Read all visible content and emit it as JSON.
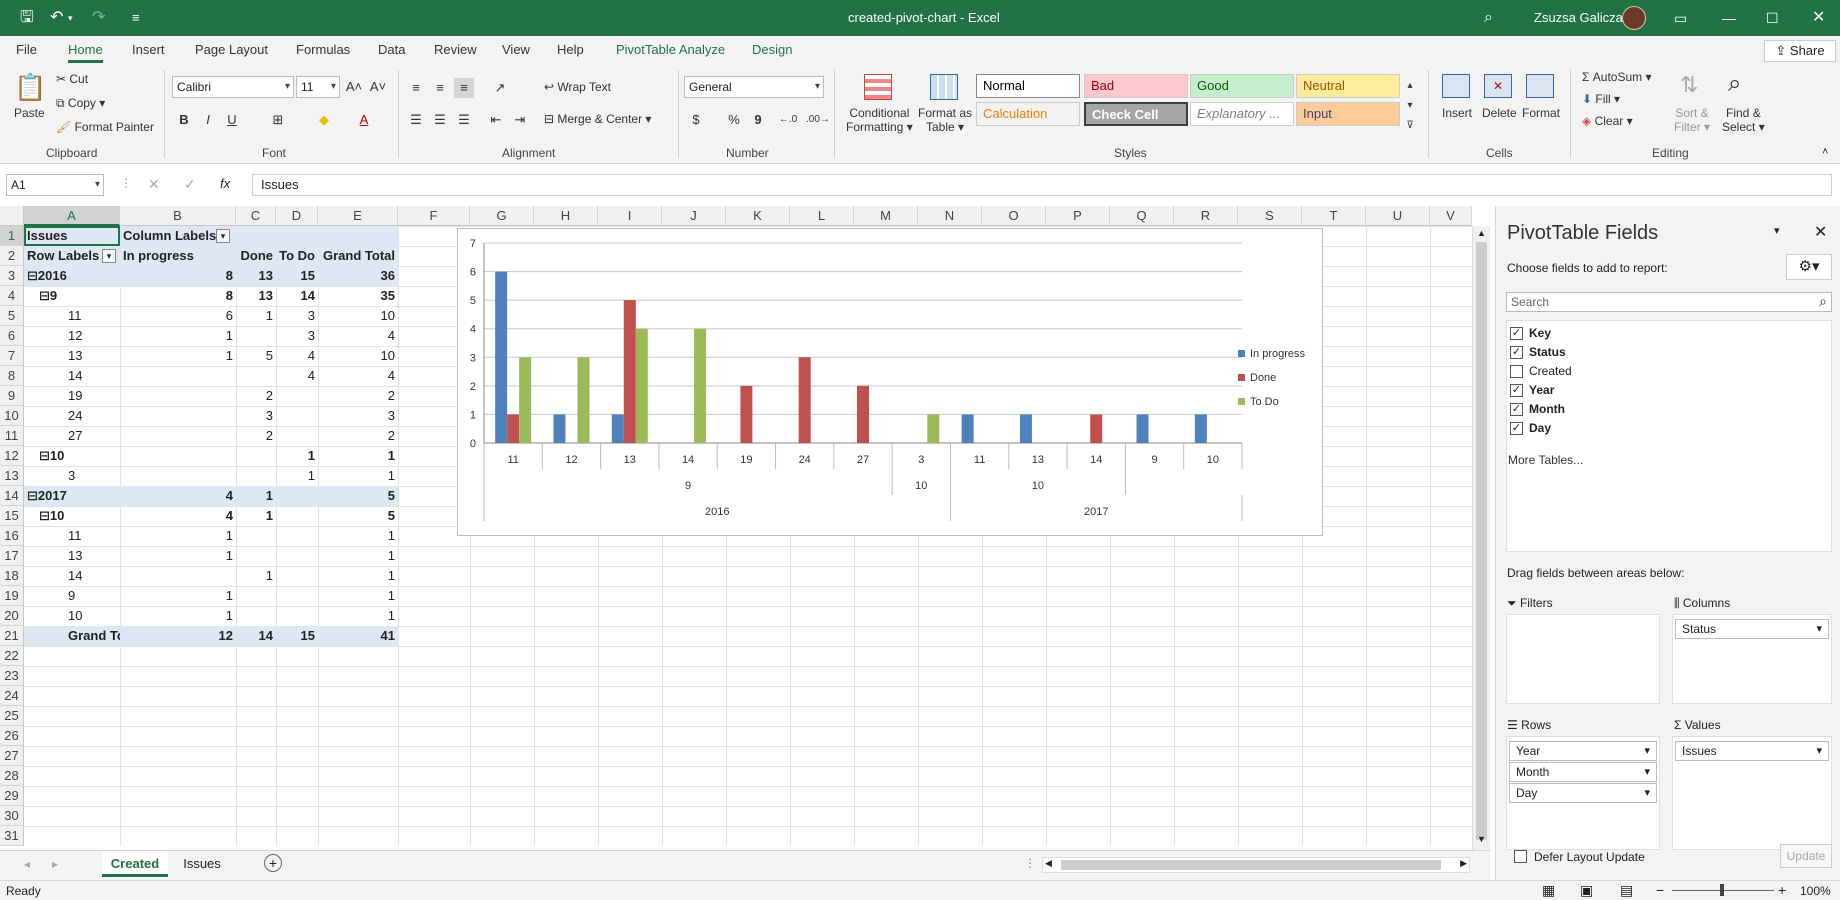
{
  "window": {
    "title": "created-pivot-chart - Excel",
    "user": "Zsuzsa Galicza",
    "accent": "#217346"
  },
  "tabs": [
    "File",
    "Home",
    "Insert",
    "Page Layout",
    "Formulas",
    "Data",
    "Review",
    "View",
    "Help",
    "PivotTable Analyze",
    "Design"
  ],
  "share_label": "Share",
  "ribbon": {
    "clipboard": {
      "paste": "Paste",
      "cut": "Cut",
      "copy": "Copy",
      "format_painter": "Format Painter",
      "label": "Clipboard"
    },
    "font": {
      "name": "Calibri",
      "size": "11",
      "label": "Font",
      "bold": "B",
      "italic": "I",
      "underline": "U"
    },
    "alignment": {
      "wrap": "Wrap Text",
      "merge": "Merge & Center",
      "label": "Alignment"
    },
    "number": {
      "format": "General",
      "label": "Number",
      "currency": "$",
      "percent": "%",
      "comma": "9"
    },
    "styles": {
      "conditional": "Conditional",
      "conditional2": "Formatting",
      "format_as": "Format as",
      "format_as2": "Table",
      "label": "Styles",
      "cells": [
        {
          "name": "Normal",
          "bg": "#ffffff",
          "fg": "#000000"
        },
        {
          "name": "Bad",
          "bg": "#ffc7ce",
          "fg": "#9c0006"
        },
        {
          "name": "Good",
          "bg": "#c6efce",
          "fg": "#006100"
        },
        {
          "name": "Neutral",
          "bg": "#ffeb9c",
          "fg": "#9c5700"
        },
        {
          "name": "Calculation",
          "bg": "#f2f2f2",
          "fg": "#fa7d00"
        },
        {
          "name": "Check Cell",
          "bg": "#a5a5a5",
          "fg": "#ffffff"
        },
        {
          "name": "Explanatory ...",
          "bg": "#ffffff",
          "fg": "#7f7f7f"
        },
        {
          "name": "Input",
          "bg": "#ffcc99",
          "fg": "#3f3f76"
        }
      ]
    },
    "cells": {
      "insert": "Insert",
      "delete": "Delete",
      "format": "Format",
      "label": "Cells"
    },
    "editing": {
      "autosum": "AutoSum",
      "fill": "Fill",
      "clear": "Clear",
      "sort": "Sort &",
      "sort2": "Filter",
      "find": "Find &",
      "find2": "Select",
      "label": "Editing"
    }
  },
  "formula": {
    "namebox": "A1",
    "content": "Issues"
  },
  "columns": [
    "A",
    "B",
    "C",
    "D",
    "E",
    "F",
    "G",
    "H",
    "I",
    "J",
    "K",
    "L",
    "M",
    "N",
    "O",
    "P",
    "Q",
    "R",
    "S",
    "T",
    "U",
    "V"
  ],
  "rows": [
    {
      "n": "1",
      "a": "Issues",
      "b": "Column Labels",
      "c": "",
      "d": "",
      "e": ""
    },
    {
      "n": "2",
      "a": "Row Labels",
      "b": "In progress",
      "c": "Done",
      "d": "To Do",
      "e": "Grand Total"
    },
    {
      "n": "3",
      "a": "⊟2016",
      "b": "8",
      "c": "13",
      "d": "15",
      "e": "36"
    },
    {
      "n": "4",
      "a": "⊟9",
      "b": "8",
      "c": "13",
      "d": "14",
      "e": "35"
    },
    {
      "n": "5",
      "a": "11",
      "b": "6",
      "c": "1",
      "d": "3",
      "e": "10"
    },
    {
      "n": "6",
      "a": "12",
      "b": "1",
      "c": "",
      "d": "3",
      "e": "4"
    },
    {
      "n": "7",
      "a": "13",
      "b": "1",
      "c": "5",
      "d": "4",
      "e": "10"
    },
    {
      "n": "8",
      "a": "14",
      "b": "",
      "c": "",
      "d": "4",
      "e": "4"
    },
    {
      "n": "9",
      "a": "19",
      "b": "",
      "c": "2",
      "d": "",
      "e": "2"
    },
    {
      "n": "10",
      "a": "24",
      "b": "",
      "c": "3",
      "d": "",
      "e": "3"
    },
    {
      "n": "11",
      "a": "27",
      "b": "",
      "c": "2",
      "d": "",
      "e": "2"
    },
    {
      "n": "12",
      "a": "⊟10",
      "b": "",
      "c": "",
      "d": "1",
      "e": "1"
    },
    {
      "n": "13",
      "a": "3",
      "b": "",
      "c": "",
      "d": "1",
      "e": "1"
    },
    {
      "n": "14",
      "a": "⊟2017",
      "b": "4",
      "c": "1",
      "d": "",
      "e": "5"
    },
    {
      "n": "15",
      "a": "⊟10",
      "b": "4",
      "c": "1",
      "d": "",
      "e": "5"
    },
    {
      "n": "16",
      "a": "11",
      "b": "1",
      "c": "",
      "d": "",
      "e": "1"
    },
    {
      "n": "17",
      "a": "13",
      "b": "1",
      "c": "",
      "d": "",
      "e": "1"
    },
    {
      "n": "18",
      "a": "14",
      "b": "",
      "c": "1",
      "d": "",
      "e": "1"
    },
    {
      "n": "19",
      "a": "9",
      "b": "1",
      "c": "",
      "d": "",
      "e": "1"
    },
    {
      "n": "20",
      "a": "10",
      "b": "1",
      "c": "",
      "d": "",
      "e": "1"
    },
    {
      "n": "21",
      "a": "Grand Total",
      "b": "12",
      "c": "14",
      "d": "15",
      "e": "41"
    },
    {
      "n": "22",
      "a": "",
      "b": "",
      "c": "",
      "d": "",
      "e": ""
    },
    {
      "n": "23",
      "a": "",
      "b": "",
      "c": "",
      "d": "",
      "e": ""
    },
    {
      "n": "24",
      "a": "",
      "b": "",
      "c": "",
      "d": "",
      "e": ""
    },
    {
      "n": "25",
      "a": "",
      "b": "",
      "c": "",
      "d": "",
      "e": ""
    },
    {
      "n": "26",
      "a": "",
      "b": "",
      "c": "",
      "d": "",
      "e": ""
    },
    {
      "n": "27",
      "a": "",
      "b": "",
      "c": "",
      "d": "",
      "e": ""
    },
    {
      "n": "28",
      "a": "",
      "b": "",
      "c": "",
      "d": "",
      "e": ""
    },
    {
      "n": "29",
      "a": "",
      "b": "",
      "c": "",
      "d": "",
      "e": ""
    },
    {
      "n": "30",
      "a": "",
      "b": "",
      "c": "",
      "d": "",
      "e": ""
    },
    {
      "n": "31",
      "a": "",
      "b": "",
      "c": "",
      "d": "",
      "e": ""
    }
  ],
  "chart_data": {
    "type": "bar",
    "categories": [
      "11",
      "12",
      "13",
      "14",
      "19",
      "24",
      "27",
      "3",
      "11",
      "13",
      "14",
      "9",
      "10"
    ],
    "month_groups": [
      {
        "label": "9",
        "span": 7
      },
      {
        "label": "10",
        "span": 1
      },
      {
        "label": "10",
        "span": 3
      },
      {
        "label": "9",
        "span": 1
      },
      {
        "label": "10",
        "span": 1
      }
    ],
    "month_labels_shown": [
      "9",
      "10",
      "10"
    ],
    "year_groups": [
      {
        "label": "2016",
        "span": 8
      },
      {
        "label": "2017",
        "span": 5
      }
    ],
    "series": [
      {
        "name": "In progress",
        "color": "#4f81bd",
        "values": [
          6,
          1,
          1,
          0,
          0,
          0,
          0,
          0,
          1,
          1,
          0,
          1,
          1
        ]
      },
      {
        "name": "Done",
        "color": "#c0504d",
        "values": [
          1,
          0,
          5,
          0,
          2,
          3,
          2,
          0,
          0,
          0,
          1,
          0,
          0
        ]
      },
      {
        "name": "To Do",
        "color": "#9bbb59",
        "values": [
          3,
          3,
          4,
          4,
          0,
          0,
          0,
          1,
          0,
          0,
          0,
          0,
          0
        ]
      }
    ],
    "ylim": [
      0,
      7
    ],
    "yticks": [
      "0",
      "1",
      "2",
      "3",
      "4",
      "5",
      "6",
      "7"
    ],
    "grid": true,
    "legend": "right"
  },
  "pane": {
    "title": "PivotTable Fields",
    "subtitle": "Choose fields to add to report:",
    "search_placeholder": "Search",
    "fields": [
      {
        "name": "Key",
        "checked": true
      },
      {
        "name": "Status",
        "checked": true
      },
      {
        "name": "Created",
        "checked": false
      },
      {
        "name": "Year",
        "checked": true
      },
      {
        "name": "Month",
        "checked": true
      },
      {
        "name": "Day",
        "checked": true
      }
    ],
    "more_tables": "More Tables...",
    "drag_hint": "Drag fields between areas below:",
    "filters": "Filters",
    "columns": "Columns",
    "rows": "Rows",
    "values": "Values",
    "columns_items": [
      "Status"
    ],
    "rows_items": [
      "Year",
      "Month",
      "Day"
    ],
    "values_items": [
      "Issues"
    ],
    "defer": "Defer Layout Update",
    "update": "Update"
  },
  "sheets": [
    {
      "name": "Created",
      "active": true
    },
    {
      "name": "Issues",
      "active": false
    }
  ],
  "status": {
    "ready": "Ready",
    "zoom": "100%"
  }
}
